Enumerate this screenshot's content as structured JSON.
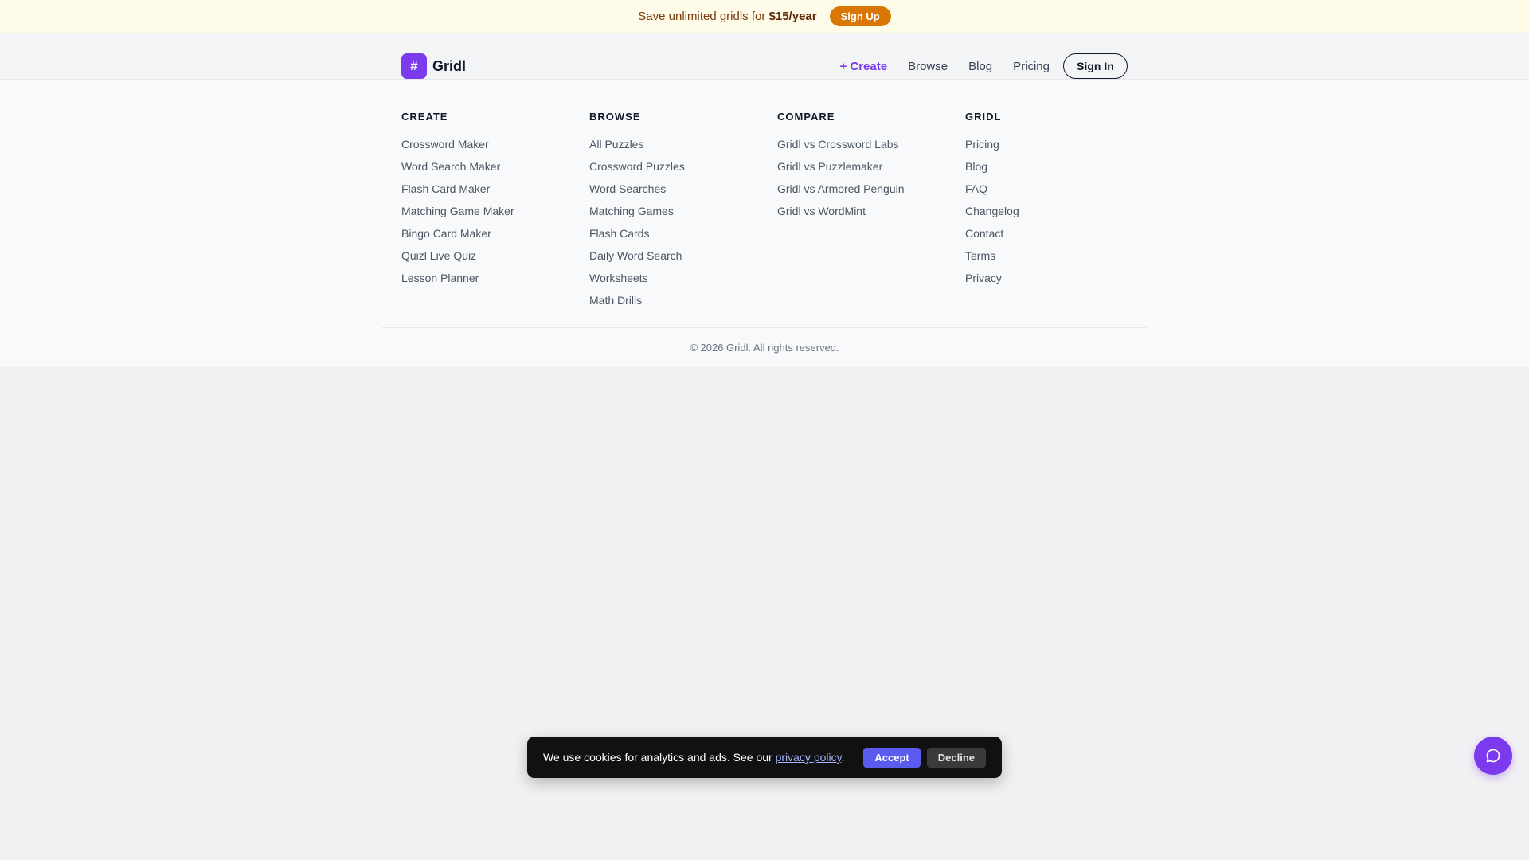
{
  "promo": {
    "text": "Save unlimited gridls for",
    "price": "$15/year",
    "signup_label": "Sign Up"
  },
  "header": {
    "logo_symbol": "#",
    "logo_text": "Gridl",
    "nav": {
      "create": "+ Create",
      "browse": "Browse",
      "blog": "Blog",
      "pricing": "Pricing",
      "signin": "Sign In"
    }
  },
  "footer": {
    "columns": [
      {
        "title": "CREATE",
        "links": [
          "Crossword Maker",
          "Word Search Maker",
          "Flash Card Maker",
          "Matching Game Maker",
          "Bingo Card Maker",
          "Quizl Live Quiz",
          "Lesson Planner"
        ]
      },
      {
        "title": "BROWSE",
        "links": [
          "All Puzzles",
          "Crossword Puzzles",
          "Word Searches",
          "Matching Games",
          "Flash Cards",
          "Daily Word Search",
          "Worksheets",
          "Math Drills"
        ]
      },
      {
        "title": "COMPARE",
        "links": [
          "Gridl vs Crossword Labs",
          "Gridl vs Puzzlemaker",
          "Gridl vs Armored Penguin",
          "Gridl vs WordMint"
        ]
      },
      {
        "title": "GRIDL",
        "links": [
          "Pricing",
          "Blog",
          "FAQ",
          "Changelog",
          "Contact",
          "Terms",
          "Privacy"
        ]
      }
    ],
    "copyright": "© 2026 Gridl. All rights reserved."
  },
  "cookie_banner": {
    "text_before": "We use cookies for analytics and ads. See our ",
    "link_text": "privacy policy",
    "text_after": ".",
    "accept_label": "Accept",
    "decline_label": "Decline"
  },
  "chat": {
    "icon": "chat-bubble-icon"
  },
  "colors": {
    "brand": "#7c3aed",
    "promo_button": "#d97706",
    "accept_button": "#5b5bf0"
  }
}
